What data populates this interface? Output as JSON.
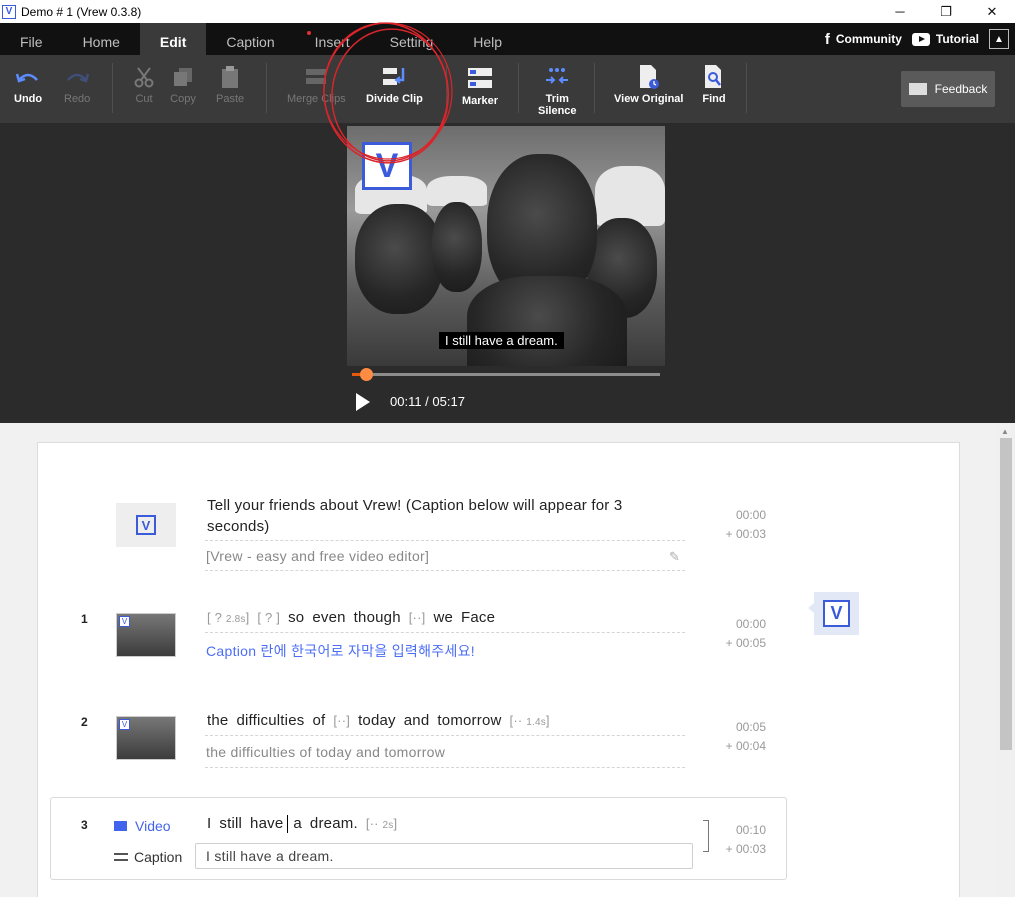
{
  "window": {
    "title": "Demo # 1 (Vrew 0.3.8)",
    "app_icon": "V",
    "controls": {
      "minimize": "─",
      "restore": "❐",
      "close": "✕"
    }
  },
  "menu": {
    "items": [
      "File",
      "Home",
      "Edit",
      "Caption",
      "Insert",
      "Setting",
      "Help"
    ],
    "active": "Edit",
    "community": "Community",
    "tutorial": "Tutorial",
    "facebook_glyph": "f",
    "collapse_glyph": "▲"
  },
  "toolbar": {
    "undo": "Undo",
    "redo": "Redo",
    "cut": "Cut",
    "copy": "Copy",
    "paste": "Paste",
    "merge_clips": "Merge Clips",
    "divide_clip": "Divide Clip",
    "marker": "Marker",
    "trim_silence": "Trim Silence",
    "trim_line1": "Trim",
    "trim_line2": "Silence",
    "view_original": "View Original",
    "find": "Find",
    "feedback": "Feedback"
  },
  "player": {
    "logo": "V",
    "subtitle": "I still have a dream.",
    "time": "00:11 / 05:17",
    "progress": 0.035,
    "accent": "#e8590c"
  },
  "clips": {
    "intro": {
      "logo": "V",
      "text": "Tell your friends about Vrew! (Caption below will appear for 3 seconds)",
      "caption": "[Vrew - easy and free video editor]",
      "start": "00:00",
      "duration": "+ 00:03"
    },
    "c1": {
      "num": "1",
      "words": [
        "so",
        "even",
        "though",
        "we",
        "Face"
      ],
      "tag_unknown": "[ ? ",
      "tag_unknown_dur": "2.8s",
      "tag_close": "]",
      "tag_q": "[ ? ]",
      "tag_gap": "[··]",
      "caption": "Caption 란에 한국어로 자막을 입력해주세요!",
      "start": "00:00",
      "duration": "+ 00:05"
    },
    "c2": {
      "num": "2",
      "words": [
        "the",
        "difficulties",
        "of",
        "today",
        "and",
        "tomorrow"
      ],
      "tag_gap": "[··]",
      "tag_end": "[·· ",
      "tag_end_dur": "1.4s",
      "caption": "the difficulties of today and tomorrow",
      "start": "00:05",
      "duration": "+ 00:04"
    },
    "c3": {
      "num": "3",
      "video_label": "Video",
      "caption_label": "Caption",
      "words": [
        "I",
        "still",
        "have",
        "a",
        "dream."
      ],
      "tag_end": "[·· ",
      "tag_end_dur": "2s",
      "caption_value": "I still have a dream.",
      "start": "00:10",
      "duration": "+ 00:03"
    }
  },
  "side_logo": "V"
}
